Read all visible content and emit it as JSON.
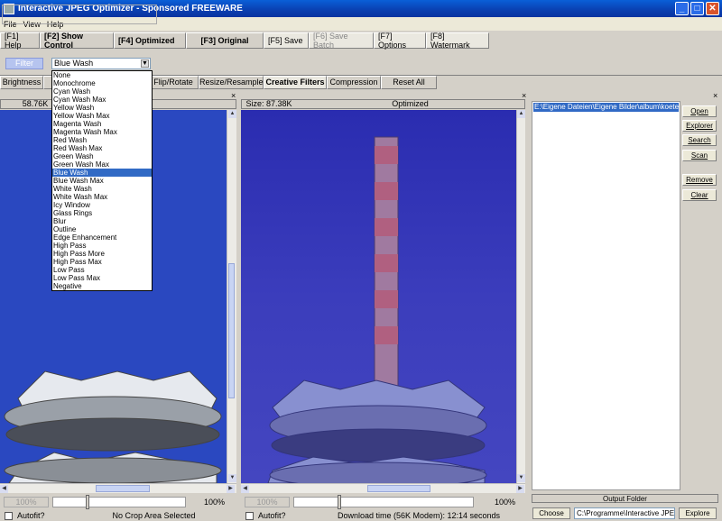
{
  "window": {
    "title": "Interactive JPEG Optimizer - Sponsored FREEWARE",
    "min": "_",
    "max": "□",
    "close": "✕"
  },
  "menu": [
    "File",
    "View",
    "Help"
  ],
  "toolbar": {
    "help": "[F1] Help",
    "show_control": "[F2] Show Control",
    "optimized": "[F4] Optimized",
    "original": "[F3] Original",
    "save": "[F5] Save",
    "save_batch": "[F6] Save Batch",
    "options": "[F7] Options",
    "watermark": "[F8] Watermark"
  },
  "filter": {
    "button": "Filter",
    "selected": "Blue Wash",
    "arrow": "▼"
  },
  "filter_options": [
    "None",
    "Monochrome",
    "Cyan Wash",
    "Cyan Wash Max",
    "Yellow Wash",
    "Yellow Wash Max",
    "Magenta Wash",
    "Magenta Wash Max",
    "Red Wash",
    "Red Wash Max",
    "Green Wash",
    "Green Wash Max",
    "Blue Wash",
    "Blue Wash Max",
    "White Wash",
    "White Wash Max",
    "Icy Window",
    "Glass Rings",
    "Blur",
    "Outline",
    "Edge Enhancement",
    "High Pass",
    "High Pass More",
    "High Pass Max",
    "Low Pass",
    "Low Pass Max",
    "Negative"
  ],
  "subtabs": {
    "brightness": "Brightness",
    "flip_rotate": "Flip/Rotate",
    "resize": "Resize/Resample",
    "creative": "Creative Filters",
    "compression": "Compression",
    "reset": "Reset All"
  },
  "left_pane": {
    "size": "58.76K",
    "zoom": "100%",
    "zoom_right": "100%",
    "autofit": "Autofit?",
    "status": "No Crop Area Selected",
    "close": "×"
  },
  "mid_pane": {
    "size": "Size: 87.38K",
    "label": "Optimized",
    "zoom": "100%",
    "zoom_right": "100%",
    "autofit": "Autofit?",
    "status": "Download time (56K Modem): 12:14 seconds",
    "close": "×"
  },
  "right_pane": {
    "close": "×",
    "file": "E:\\Eigene Dateien\\Eigene Bilder\\album\\koeterberg",
    "buttons": {
      "open": "Open",
      "explorer": "Explorer",
      "search": "Search",
      "scan": "Scan",
      "remove": "Remove",
      "clear": "Clear"
    },
    "output_label": "Output Folder",
    "choose": "Choose",
    "output_path": "C:\\Programme\\Interactive JPEG Optimizer",
    "explore": "Explore"
  },
  "colors": {
    "titlebar": "#0a5fd8",
    "selection": "#316ac5"
  }
}
